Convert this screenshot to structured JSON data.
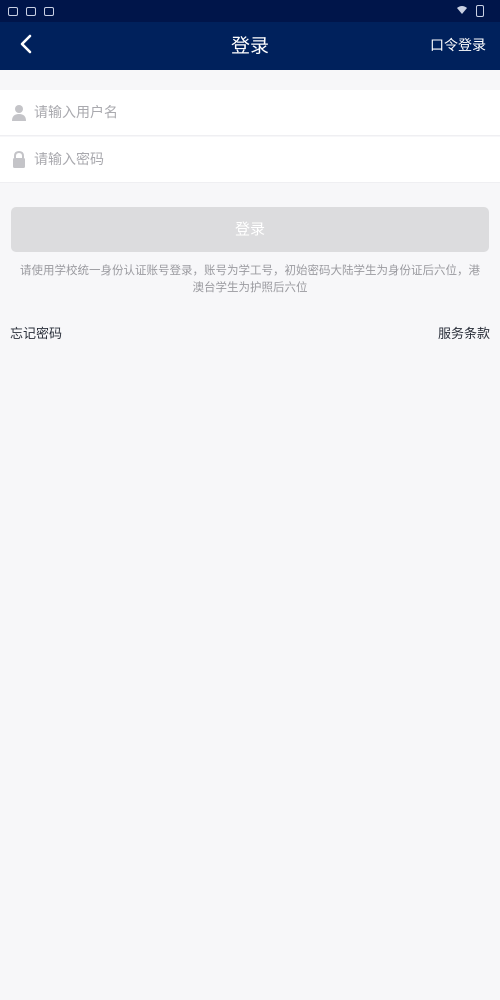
{
  "statusbar": {
    "time": ""
  },
  "navbar": {
    "title": "登录",
    "right_label": "口令登录"
  },
  "form": {
    "username_placeholder": "请输入用户名",
    "username_value": "",
    "password_placeholder": "请输入密码",
    "password_value": ""
  },
  "login_button": {
    "label": "登录"
  },
  "hint": "请使用学校统一身份认证账号登录，账号为学工号，初始密码大陆学生为身份证后六位，港澳台学生为护照后六位",
  "links": {
    "forgot_password": "忘记密码",
    "terms": "服务条款"
  },
  "colors": {
    "navbar": "#00215c",
    "statusbar": "#00154a",
    "button_disabled": "#dcdcde",
    "background": "#f7f7f9"
  }
}
